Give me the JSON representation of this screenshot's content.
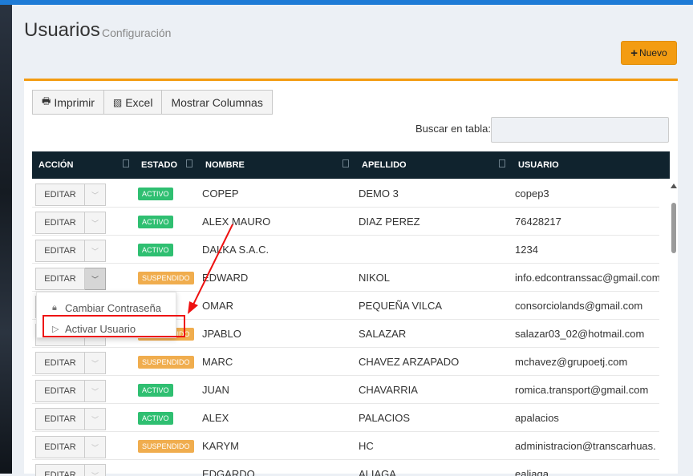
{
  "header": {
    "title": "Usuarios",
    "subtitle": "Configuración",
    "new_button": "Nuevo"
  },
  "toolbar": {
    "print_label": "Imprimir",
    "excel_label": "Excel",
    "columns_label": "Mostrar Columnas"
  },
  "search": {
    "label": "Buscar en tabla:",
    "value": ""
  },
  "table": {
    "columns": [
      "ACCIÓN",
      "ESTADO",
      "NOMBRE",
      "APELLIDO",
      "USUARIO"
    ],
    "edit_label": "EDITAR",
    "rows": [
      {
        "estado": "ACTIVO",
        "nombre": "COPEP",
        "apellido": "DEMO 3",
        "usuario": "copep3"
      },
      {
        "estado": "ACTIVO",
        "nombre": "ALEX MAURO",
        "apellido": "DIAZ PEREZ",
        "usuario": "76428217"
      },
      {
        "estado": "ACTIVO",
        "nombre": "DALKA S.A.C.",
        "apellido": "",
        "usuario": "1234"
      },
      {
        "estado": "SUSPENDIDO",
        "nombre": "EDWARD",
        "apellido": "NIKOL",
        "usuario": "info.edcontranssac@gmail.com"
      },
      {
        "estado": "",
        "nombre": "OMAR",
        "apellido": "PEQUEÑA VILCA",
        "usuario": "consorciolands@gmail.com"
      },
      {
        "estado": "SUSPENDIDO",
        "nombre": "JPABLO",
        "apellido": "SALAZAR",
        "usuario": "salazar03_02@hotmail.com"
      },
      {
        "estado": "SUSPENDIDO",
        "nombre": "MARC",
        "apellido": "CHAVEZ ARZAPADO",
        "usuario": "mchavez@grupoetj.com"
      },
      {
        "estado": "ACTIVO",
        "nombre": "JUAN",
        "apellido": "CHAVARRIA",
        "usuario": "romica.transport@gmail.com"
      },
      {
        "estado": "ACTIVO",
        "nombre": "ALEX",
        "apellido": "PALACIOS",
        "usuario": "apalacios"
      },
      {
        "estado": "SUSPENDIDO",
        "nombre": "KARYM",
        "apellido": "HC",
        "usuario": "administracion@transcarhuas."
      },
      {
        "estado": "",
        "nombre": "EDGARDO",
        "apellido": "ALIAGA",
        "usuario": "ealiaga"
      }
    ]
  },
  "dropdown": {
    "items": [
      "Cambiar Contraseña",
      "Activar Usuario"
    ]
  },
  "colors": {
    "accent": "#f39c12",
    "header_bg": "#10232e",
    "active": "#2fbf71",
    "suspended": "#f0ad4e",
    "highlight": "#e11111"
  }
}
